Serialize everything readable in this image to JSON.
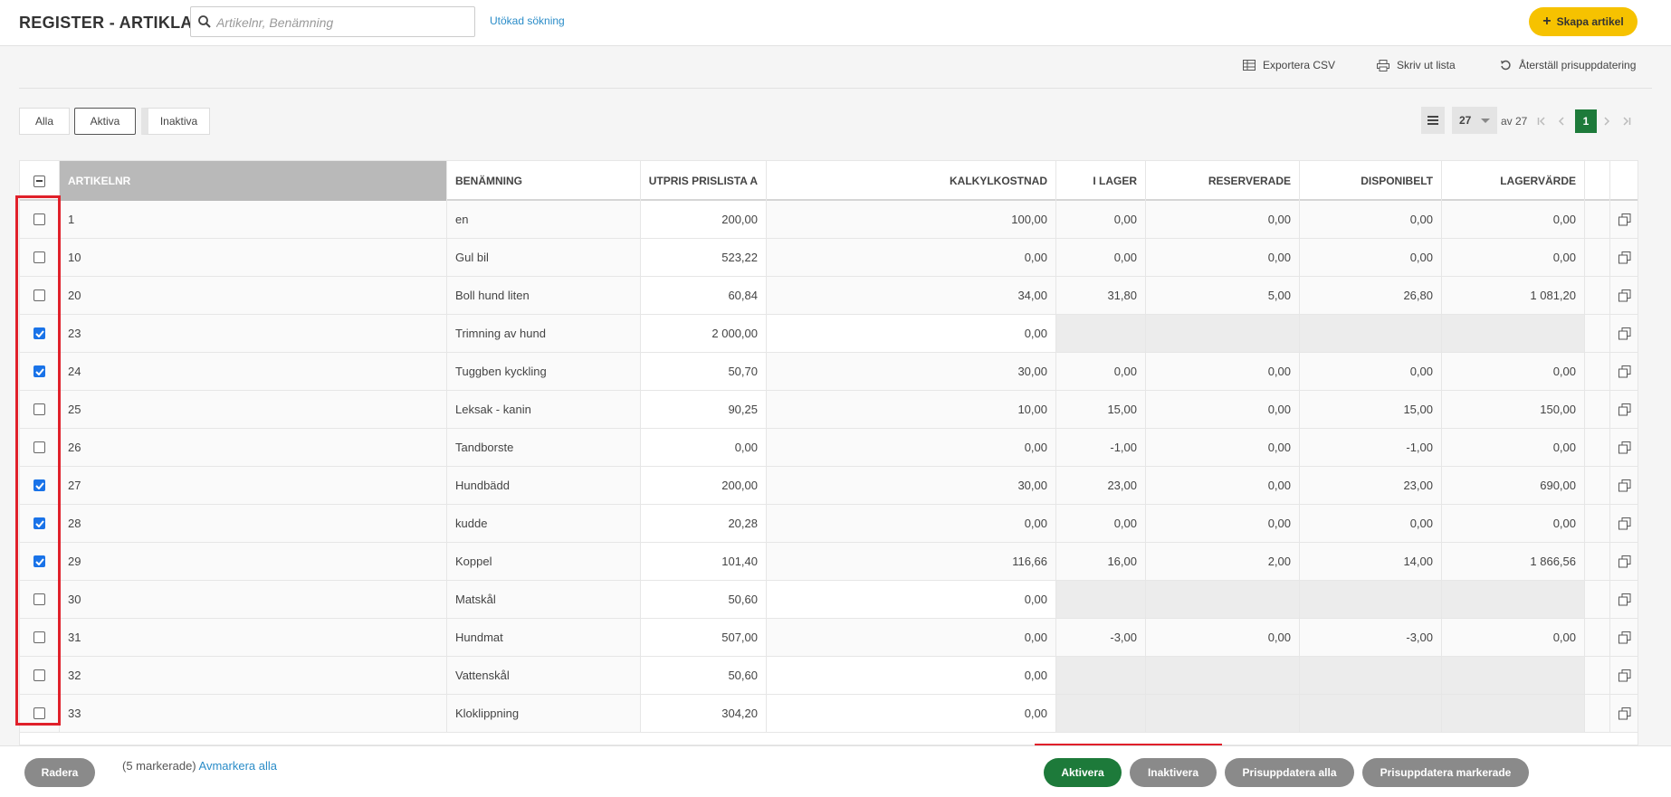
{
  "header": {
    "title": "REGISTER - ARTIKLAR",
    "search_placeholder": "Artikelnr, Benämning",
    "advanced_search": "Utökad sökning",
    "create_button": "Skapa artikel"
  },
  "toolbar": {
    "export_csv": "Exportera CSV",
    "print_list": "Skriv ut lista",
    "reset_price_update": "Återställ prisuppdatering"
  },
  "filters": {
    "all": "Alla",
    "active": "Aktiva",
    "inactive": "Inaktiva",
    "selected": "Aktiva"
  },
  "pager": {
    "page_size": "27",
    "of_total": "av 27",
    "current_page": "1"
  },
  "table": {
    "columns": {
      "artikelnr": "ARTIKELNR",
      "benamning": "BENÄMNING",
      "utpris": "UTPRIS PRISLISTA A",
      "kalkyl": "KALKYLKOSTNAD",
      "ilager": "I LAGER",
      "reserverade": "RESERVERADE",
      "disponibelt": "DISPONIBELT",
      "lagervarde": "LAGERVÄRDE"
    },
    "rows": [
      {
        "checked": false,
        "artikelnr": "1",
        "benamning": "en",
        "utpris": "200,00",
        "kalkyl": "100,00",
        "ilager": "0,00",
        "reserverade": "0,00",
        "disponibelt": "0,00",
        "lagervarde": "0,00",
        "stock": true
      },
      {
        "checked": false,
        "artikelnr": "10",
        "benamning": "Gul bil",
        "utpris": "523,22",
        "kalkyl": "0,00",
        "ilager": "0,00",
        "reserverade": "0,00",
        "disponibelt": "0,00",
        "lagervarde": "0,00",
        "stock": true
      },
      {
        "checked": false,
        "artikelnr": "20",
        "benamning": "Boll hund liten",
        "utpris": "60,84",
        "kalkyl": "34,00",
        "ilager": "31,80",
        "reserverade": "5,00",
        "disponibelt": "26,80",
        "lagervarde": "1 081,20",
        "stock": true
      },
      {
        "checked": true,
        "artikelnr": "23",
        "benamning": "Trimning av hund",
        "utpris": "2 000,00",
        "kalkyl": "0,00",
        "ilager": "",
        "reserverade": "",
        "disponibelt": "",
        "lagervarde": "",
        "stock": false
      },
      {
        "checked": true,
        "artikelnr": "24",
        "benamning": "Tuggben kyckling",
        "utpris": "50,70",
        "kalkyl": "30,00",
        "ilager": "0,00",
        "reserverade": "0,00",
        "disponibelt": "0,00",
        "lagervarde": "0,00",
        "stock": true
      },
      {
        "checked": false,
        "artikelnr": "25",
        "benamning": "Leksak - kanin",
        "utpris": "90,25",
        "kalkyl": "10,00",
        "ilager": "15,00",
        "reserverade": "0,00",
        "disponibelt": "15,00",
        "lagervarde": "150,00",
        "stock": true
      },
      {
        "checked": false,
        "artikelnr": "26",
        "benamning": "Tandborste",
        "utpris": "0,00",
        "kalkyl": "0,00",
        "ilager": "-1,00",
        "reserverade": "0,00",
        "disponibelt": "-1,00",
        "lagervarde": "0,00",
        "stock": true
      },
      {
        "checked": true,
        "artikelnr": "27",
        "benamning": "Hundbädd",
        "utpris": "200,00",
        "kalkyl": "30,00",
        "ilager": "23,00",
        "reserverade": "0,00",
        "disponibelt": "23,00",
        "lagervarde": "690,00",
        "stock": true
      },
      {
        "checked": true,
        "artikelnr": "28",
        "benamning": "kudde",
        "utpris": "20,28",
        "kalkyl": "0,00",
        "ilager": "0,00",
        "reserverade": "0,00",
        "disponibelt": "0,00",
        "lagervarde": "0,00",
        "stock": true
      },
      {
        "checked": true,
        "artikelnr": "29",
        "benamning": "Koppel",
        "utpris": "101,40",
        "kalkyl": "116,66",
        "ilager": "16,00",
        "reserverade": "2,00",
        "disponibelt": "14,00",
        "lagervarde": "1 866,56",
        "stock": true
      },
      {
        "checked": false,
        "artikelnr": "30",
        "benamning": "Matskål",
        "utpris": "50,60",
        "kalkyl": "0,00",
        "ilager": "",
        "reserverade": "",
        "disponibelt": "",
        "lagervarde": "",
        "stock": false
      },
      {
        "checked": false,
        "artikelnr": "31",
        "benamning": "Hundmat",
        "utpris": "507,00",
        "kalkyl": "0,00",
        "ilager": "-3,00",
        "reserverade": "0,00",
        "disponibelt": "-3,00",
        "lagervarde": "0,00",
        "stock": true
      },
      {
        "checked": false,
        "artikelnr": "32",
        "benamning": "Vattenskål",
        "utpris": "50,60",
        "kalkyl": "0,00",
        "ilager": "",
        "reserverade": "",
        "disponibelt": "",
        "lagervarde": "",
        "stock": false
      },
      {
        "checked": false,
        "artikelnr": "33",
        "benamning": "Kloklippning",
        "utpris": "304,20",
        "kalkyl": "0,00",
        "ilager": "",
        "reserverade": "",
        "disponibelt": "",
        "lagervarde": "",
        "stock": false
      }
    ]
  },
  "bottom": {
    "delete": "Radera",
    "selected_count": "(5 markerade)",
    "deselect_all": "Avmarkera alla",
    "activate": "Aktivera",
    "deactivate": "Inaktivera",
    "price_update_all": "Prisuppdatera alla",
    "price_update_selected": "Prisuppdatera markerade"
  },
  "colors": {
    "accent_green": "#1d7a3a",
    "create_yellow": "#f6c200",
    "link_blue": "#2a8cc8",
    "highlight_red": "#e0202a"
  }
}
